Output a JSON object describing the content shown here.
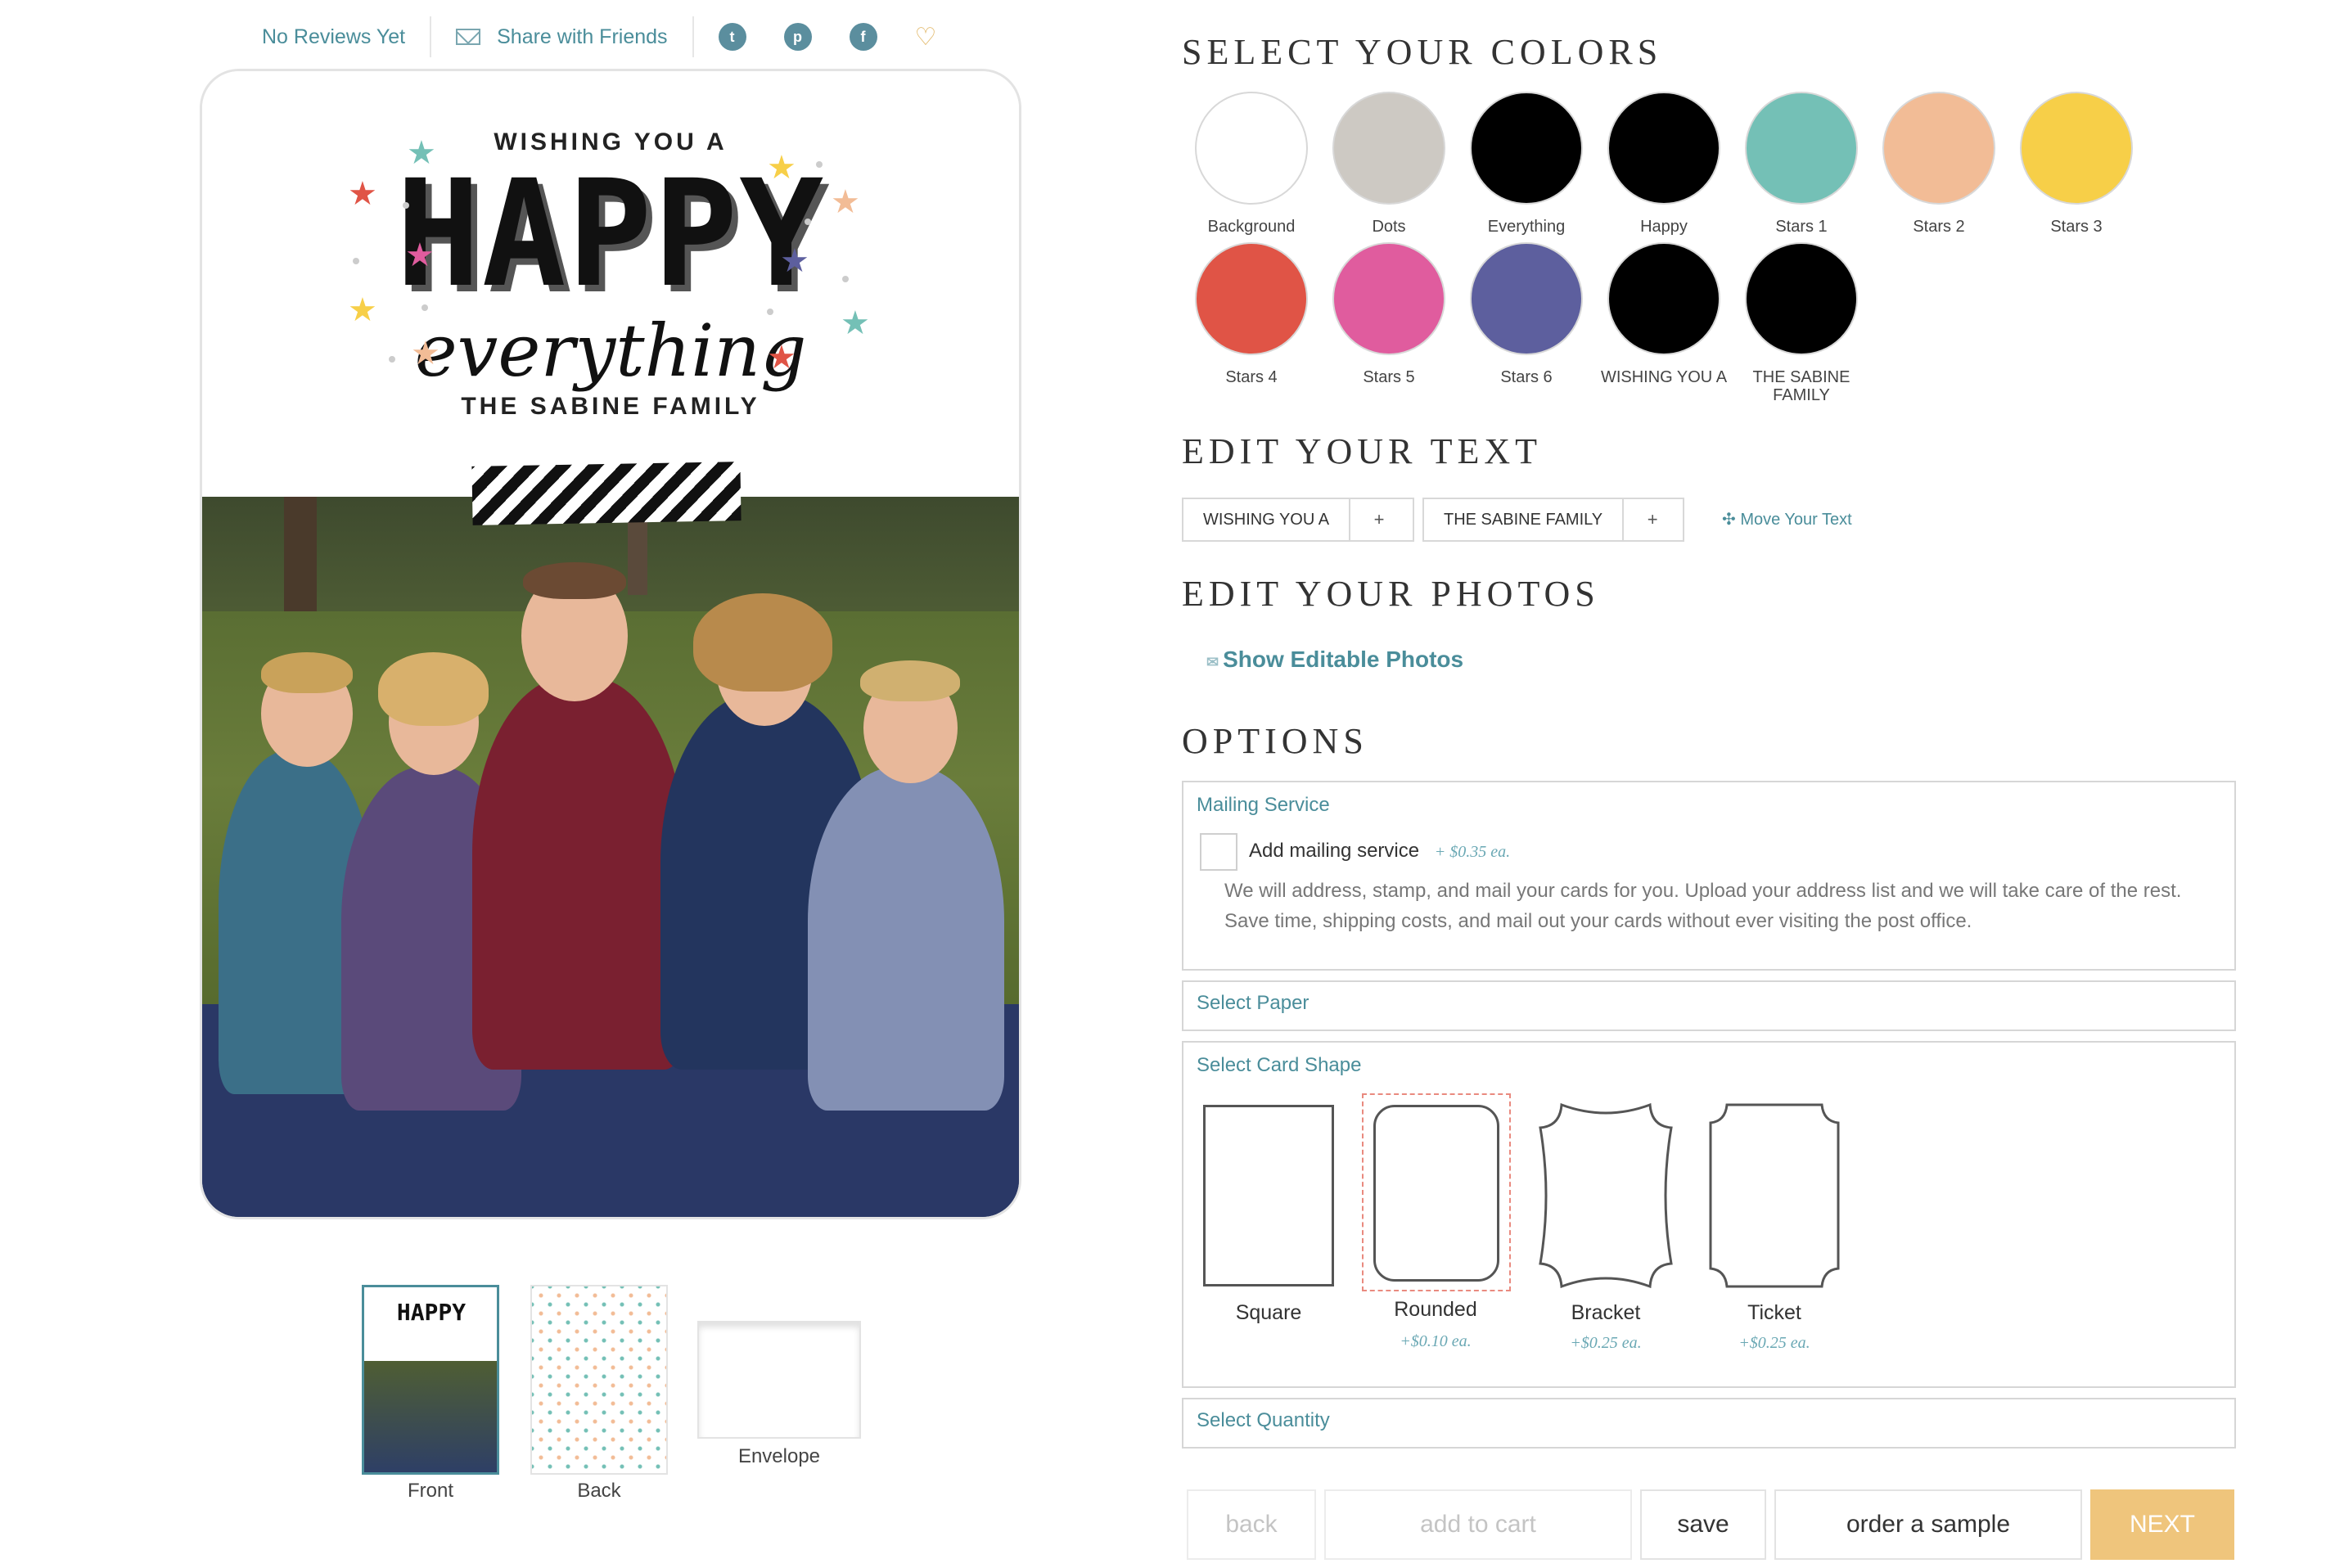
{
  "share": {
    "reviews": "No Reviews Yet",
    "share_label": "Share with Friends",
    "social": [
      "twitter-icon",
      "pinterest-icon",
      "facebook-icon"
    ],
    "social_glyphs": [
      "t",
      "p",
      "f"
    ]
  },
  "card": {
    "line1": "WISHING YOU A",
    "line2": "HAPPY",
    "line3": "everything",
    "line4": "THE SABINE FAMILY"
  },
  "thumbnails": [
    {
      "label": "Front"
    },
    {
      "label": "Back"
    },
    {
      "label": "Envelope"
    }
  ],
  "colors": {
    "heading": "SELECT YOUR COLORS",
    "swatches": [
      {
        "label": "Background",
        "color": "#ffffff"
      },
      {
        "label": "Dots",
        "color": "#cdc9c3"
      },
      {
        "label": "Everything",
        "color": "#000000"
      },
      {
        "label": "Happy",
        "color": "#000000"
      },
      {
        "label": "Stars 1",
        "color": "#74c0b6"
      },
      {
        "label": "Stars 2",
        "color": "#f2bc96"
      },
      {
        "label": "Stars 3",
        "color": "#f7cf48"
      },
      {
        "label": "Stars 4",
        "color": "#e05446"
      },
      {
        "label": "Stars 5",
        "color": "#e05c9e"
      },
      {
        "label": "Stars 6",
        "color": "#5d5f9e"
      },
      {
        "label": "WISHING YOU A",
        "color": "#000000"
      },
      {
        "label": "THE SABINE FAMILY",
        "color": "#000000"
      }
    ]
  },
  "text": {
    "heading": "EDIT YOUR TEXT",
    "fields": [
      "WISHING YOU A",
      "THE SABINE FAMILY"
    ],
    "plus": "+",
    "move": "Move Your Text"
  },
  "photos": {
    "heading": "EDIT YOUR PHOTOS",
    "show": "Show Editable Photos"
  },
  "options": {
    "heading": "OPTIONS",
    "mailing": {
      "title": "Mailing Service",
      "checkbox_label": "Add mailing service",
      "price": "+ $0.35 ea.",
      "description": "We will address, stamp, and mail your cards for you. Upload your address list and we will take care of the rest. Save time, shipping costs, and mail out your cards without ever visiting the post office."
    },
    "paper": {
      "title": "Select Paper"
    },
    "shape": {
      "title": "Select Card Shape",
      "shapes": [
        {
          "label": "Square",
          "price": ""
        },
        {
          "label": "Rounded",
          "price": "+$0.10 ea."
        },
        {
          "label": "Bracket",
          "price": "+$0.25 ea."
        },
        {
          "label": "Ticket",
          "price": "+$0.25 ea."
        }
      ]
    },
    "quantity": {
      "title": "Select Quantity"
    }
  },
  "actions": {
    "back": "back",
    "add_to_cart": "add to cart",
    "save": "save",
    "order_sample": "order a sample",
    "next": "NEXT"
  },
  "accent_colors": {
    "teal": "#4a8d9a",
    "next": "#efc57c",
    "selected_shape": "#e98a7f"
  }
}
